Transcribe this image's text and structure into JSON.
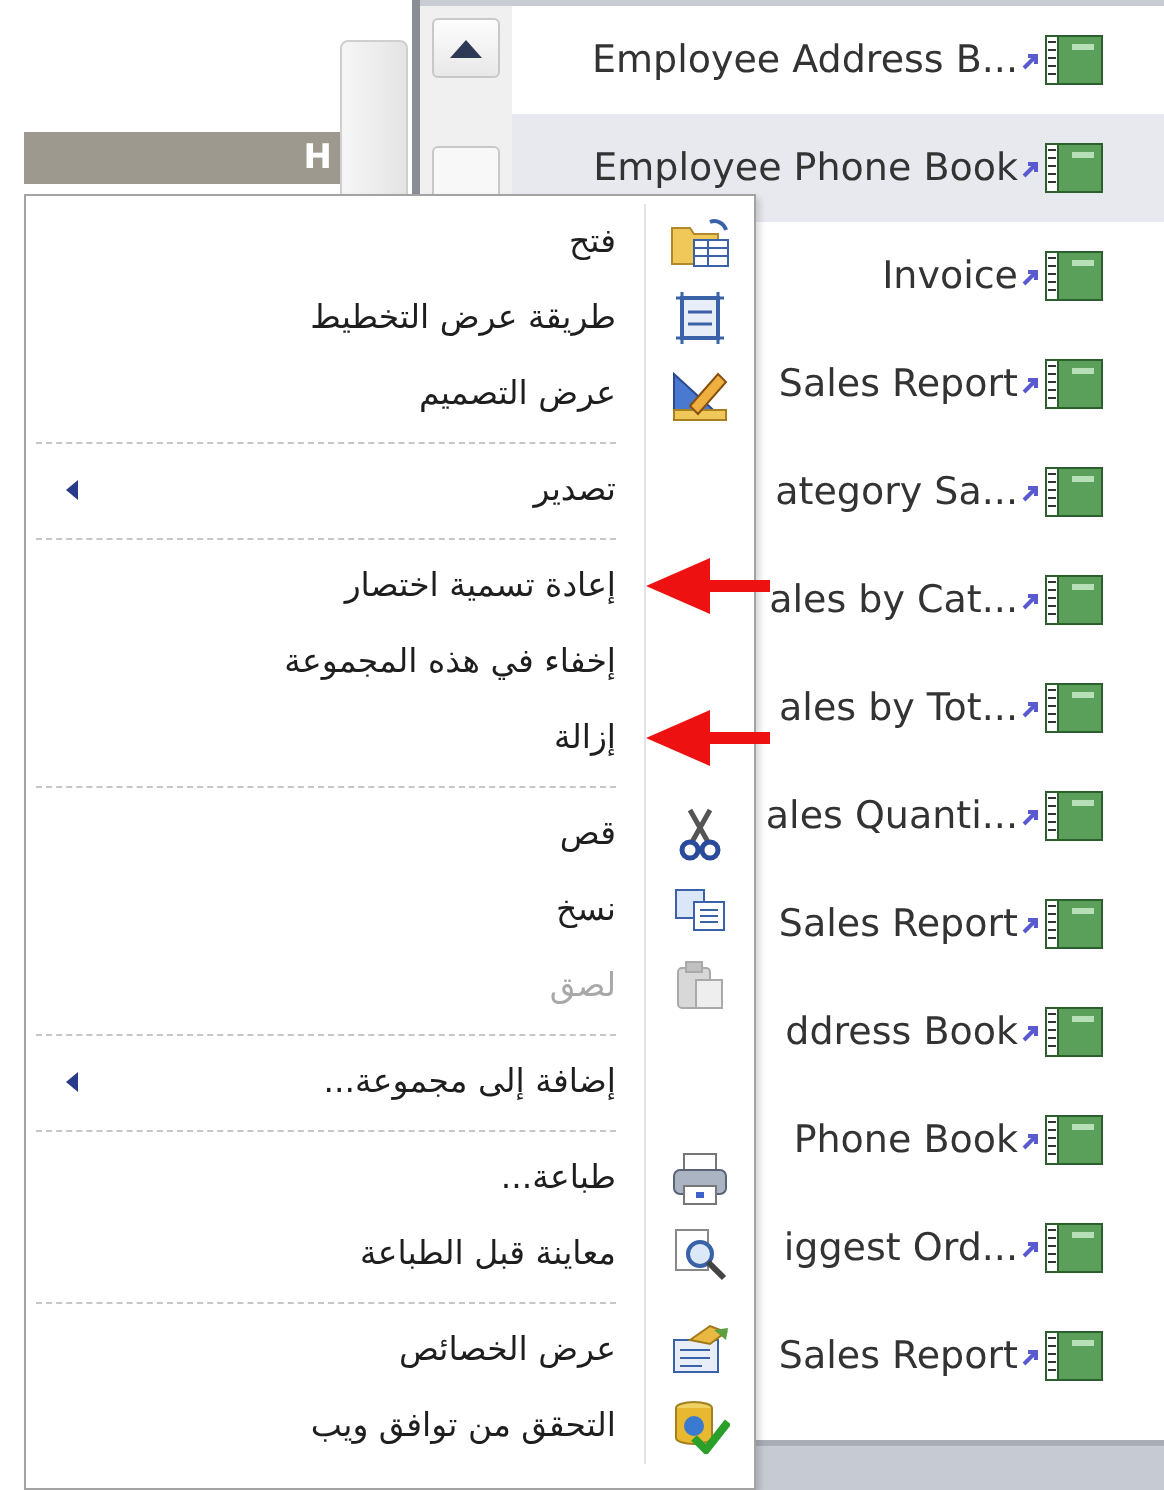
{
  "nav_header": {
    "text": "H"
  },
  "list_items": [
    {
      "label": "Employee Address B...",
      "selected": false
    },
    {
      "label": "Employee Phone Book",
      "selected": true
    },
    {
      "label": "Invoice",
      "selected": false
    },
    {
      "label": "Sales Report",
      "selected": false
    },
    {
      "label": "ategory Sa...",
      "selected": false
    },
    {
      "label": "ales by Cat...",
      "selected": false
    },
    {
      "label": "ales by Tot...",
      "selected": false
    },
    {
      "label": "ales Quanti...",
      "selected": false
    },
    {
      "label": "Sales Report",
      "selected": false
    },
    {
      "label": "ddress Book",
      "selected": false
    },
    {
      "label": "Phone Book",
      "selected": false
    },
    {
      "label": "iggest Ord...",
      "selected": false
    },
    {
      "label": "Sales Report",
      "selected": false
    }
  ],
  "context_menu": {
    "items": [
      {
        "kind": "command",
        "label": "فتح",
        "disabled": false,
        "submenu": false,
        "marked": false
      },
      {
        "kind": "command",
        "label": "طريقة عرض التخطيط",
        "disabled": false,
        "submenu": false,
        "marked": false
      },
      {
        "kind": "command",
        "label": "عرض التصميم",
        "disabled": false,
        "submenu": false,
        "marked": false
      },
      {
        "kind": "separator"
      },
      {
        "kind": "command",
        "label": "تصدير",
        "disabled": false,
        "submenu": true,
        "marked": false
      },
      {
        "kind": "separator"
      },
      {
        "kind": "command",
        "label": "إعادة تسمية اختصار",
        "disabled": false,
        "submenu": false,
        "marked": true
      },
      {
        "kind": "command",
        "label": "إخفاء في هذه المجموعة",
        "disabled": false,
        "submenu": false,
        "marked": false
      },
      {
        "kind": "command",
        "label": "إزالة",
        "disabled": false,
        "submenu": false,
        "marked": true
      },
      {
        "kind": "separator"
      },
      {
        "kind": "command",
        "label": "قص",
        "disabled": false,
        "submenu": false,
        "marked": false
      },
      {
        "kind": "command",
        "label": "نسخ",
        "disabled": false,
        "submenu": false,
        "marked": false
      },
      {
        "kind": "command",
        "label": "لصق",
        "disabled": true,
        "submenu": false,
        "marked": false
      },
      {
        "kind": "separator"
      },
      {
        "kind": "command",
        "label": "إضافة إلى مجموعة...",
        "disabled": false,
        "submenu": true,
        "marked": false
      },
      {
        "kind": "separator"
      },
      {
        "kind": "command",
        "label": "طباعة...",
        "disabled": false,
        "submenu": false,
        "marked": false
      },
      {
        "kind": "command",
        "label": "معاينة قبل الطباعة",
        "disabled": false,
        "submenu": false,
        "marked": false
      },
      {
        "kind": "separator"
      },
      {
        "kind": "command",
        "label": "عرض الخصائص",
        "disabled": false,
        "submenu": false,
        "marked": false
      },
      {
        "kind": "command",
        "label": "التحقق من توافق ويب",
        "disabled": false,
        "submenu": false,
        "marked": false
      }
    ]
  }
}
